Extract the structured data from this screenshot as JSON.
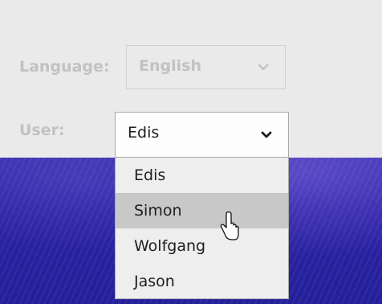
{
  "form": {
    "language_label": "Language:",
    "language_value": "English",
    "user_label": "User:",
    "user_value": "Edis"
  },
  "dropdown": {
    "options": [
      "Edis",
      "Simon",
      "Wolfgang",
      "Jason"
    ],
    "highlighted": "Simon"
  },
  "colors": {
    "background": "#eaeaea",
    "disabled_text": "#c2c2c2",
    "highlight": "#c8c8c8",
    "banner": "#2c22a6"
  },
  "icons": {
    "language_chevron": "chevron-down-icon",
    "user_chevron": "chevron-down-icon",
    "cursor": "mouse-pointer-icon"
  }
}
